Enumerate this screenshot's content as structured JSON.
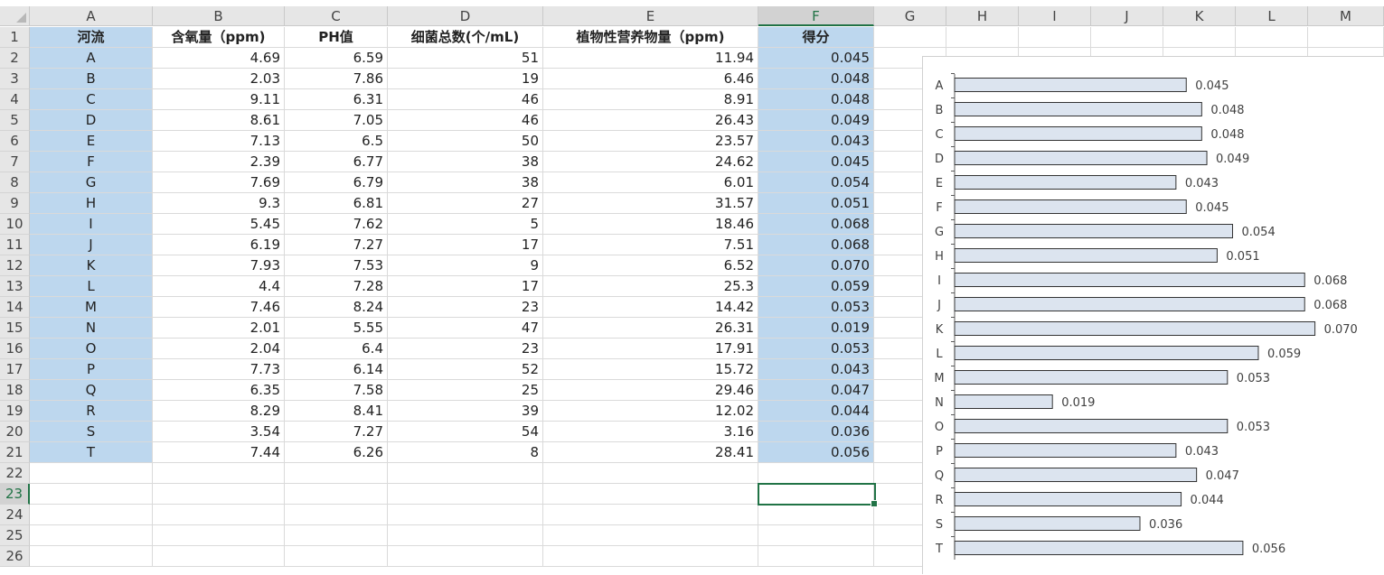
{
  "sheet": {
    "columns": [
      "A",
      "B",
      "C",
      "D",
      "E",
      "F",
      "G",
      "H",
      "I",
      "J",
      "K",
      "L",
      "M"
    ],
    "selected_column": "F",
    "rows": [
      "1",
      "2",
      "3",
      "4",
      "5",
      "6",
      "7",
      "8",
      "9",
      "10",
      "11",
      "12",
      "13",
      "14",
      "15",
      "16",
      "17",
      "18",
      "19",
      "20",
      "21",
      "22",
      "23",
      "24",
      "25",
      "26"
    ],
    "selected_row": "23",
    "headers": [
      "河流",
      "含氧量（ppm)",
      "PH值",
      "细菌总数(个/mL)",
      "植物性营养物量（ppm)",
      "得分"
    ],
    "data": [
      [
        "A",
        "4.69",
        "6.59",
        "51",
        "11.94",
        "0.045"
      ],
      [
        "B",
        "2.03",
        "7.86",
        "19",
        "6.46",
        "0.048"
      ],
      [
        "C",
        "9.11",
        "6.31",
        "46",
        "8.91",
        "0.048"
      ],
      [
        "D",
        "8.61",
        "7.05",
        "46",
        "26.43",
        "0.049"
      ],
      [
        "E",
        "7.13",
        "6.5",
        "50",
        "23.57",
        "0.043"
      ],
      [
        "F",
        "2.39",
        "6.77",
        "38",
        "24.62",
        "0.045"
      ],
      [
        "G",
        "7.69",
        "6.79",
        "38",
        "6.01",
        "0.054"
      ],
      [
        "H",
        "9.3",
        "6.81",
        "27",
        "31.57",
        "0.051"
      ],
      [
        "I",
        "5.45",
        "7.62",
        "5",
        "18.46",
        "0.068"
      ],
      [
        "J",
        "6.19",
        "7.27",
        "17",
        "7.51",
        "0.068"
      ],
      [
        "K",
        "7.93",
        "7.53",
        "9",
        "6.52",
        "0.070"
      ],
      [
        "L",
        "4.4",
        "7.28",
        "17",
        "25.3",
        "0.059"
      ],
      [
        "M",
        "7.46",
        "8.24",
        "23",
        "14.42",
        "0.053"
      ],
      [
        "N",
        "2.01",
        "5.55",
        "47",
        "26.31",
        "0.019"
      ],
      [
        "O",
        "2.04",
        "6.4",
        "23",
        "17.91",
        "0.053"
      ],
      [
        "P",
        "7.73",
        "6.14",
        "52",
        "15.72",
        "0.043"
      ],
      [
        "Q",
        "6.35",
        "7.58",
        "25",
        "29.46",
        "0.047"
      ],
      [
        "R",
        "8.29",
        "8.41",
        "39",
        "12.02",
        "0.044"
      ],
      [
        "S",
        "3.54",
        "7.27",
        "54",
        "3.16",
        "0.036"
      ],
      [
        "T",
        "7.44",
        "6.26",
        "8",
        "28.41",
        "0.056"
      ]
    ],
    "highlight_color": "#bdd7ee",
    "accent_color": "#217346"
  },
  "chart_data": {
    "type": "bar",
    "orientation": "horizontal",
    "categories": [
      "A",
      "B",
      "C",
      "D",
      "E",
      "F",
      "G",
      "H",
      "I",
      "J",
      "K",
      "L",
      "M",
      "N",
      "O",
      "P",
      "Q",
      "R",
      "S",
      "T"
    ],
    "values": [
      0.045,
      0.048,
      0.048,
      0.049,
      0.043,
      0.045,
      0.054,
      0.051,
      0.068,
      0.068,
      0.07,
      0.059,
      0.053,
      0.019,
      0.053,
      0.043,
      0.047,
      0.044,
      0.036,
      0.056
    ],
    "labels": [
      "0.045",
      "0.048",
      "0.048",
      "0.049",
      "0.043",
      "0.045",
      "0.054",
      "0.051",
      "0.068",
      "0.068",
      "0.070",
      "0.059",
      "0.053",
      "0.019",
      "0.053",
      "0.043",
      "0.047",
      "0.044",
      "0.036",
      "0.056"
    ],
    "bar_color": "#dce4ef",
    "bar_border": "#333333",
    "xlim": [
      0,
      0.072
    ],
    "grid": false,
    "legend": "none"
  }
}
